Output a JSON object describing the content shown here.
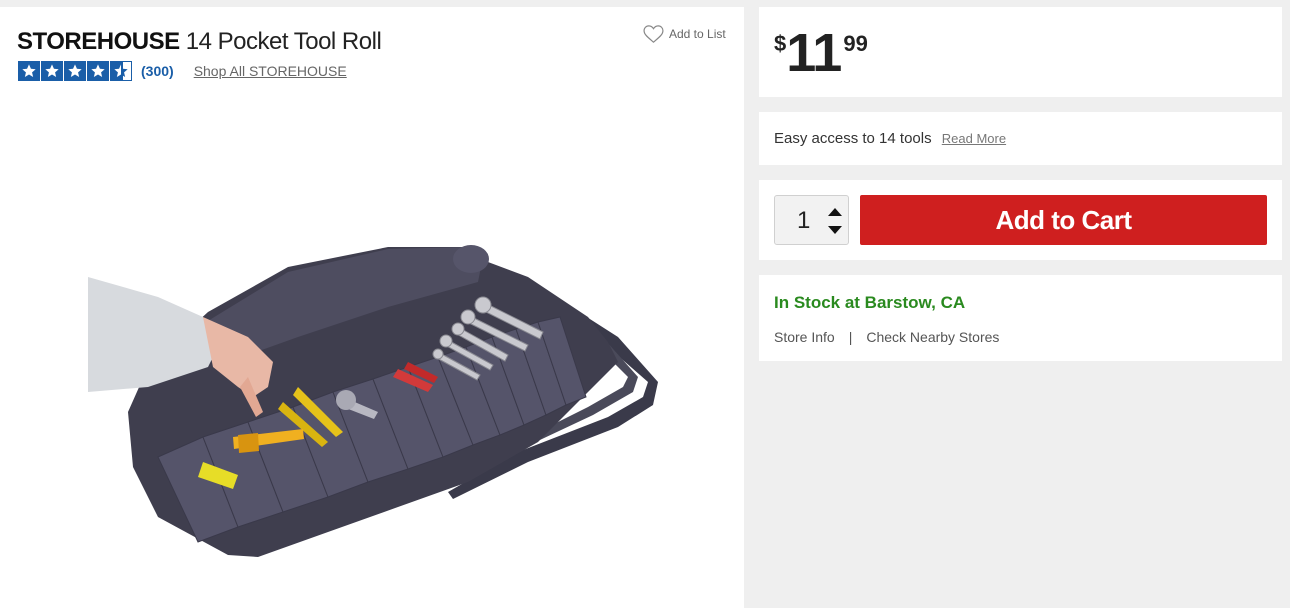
{
  "product": {
    "brand": "STOREHOUSE",
    "name": "14 Pocket Tool Roll",
    "add_to_list": "Add to List",
    "rating_count": "(300)",
    "rating_value": 4.5,
    "shop_all": "Shop All STOREHOUSE"
  },
  "price": {
    "currency": "$",
    "whole": "11",
    "cents": "99"
  },
  "description": {
    "text": "Easy access to 14 tools",
    "read_more": "Read More"
  },
  "cart": {
    "quantity": "1",
    "add_to_cart": "Add to Cart",
    "button_color": "#cf1f1f"
  },
  "stock": {
    "status": "In Stock at Barstow, CA",
    "store_info": "Store Info",
    "separator": "|",
    "check_nearby": "Check Nearby Stores",
    "status_color": "#2a8a1f"
  },
  "icons": {
    "heart": "heart-outline-icon",
    "star": "star-icon",
    "up": "caret-up-icon",
    "down": "caret-down-icon"
  }
}
